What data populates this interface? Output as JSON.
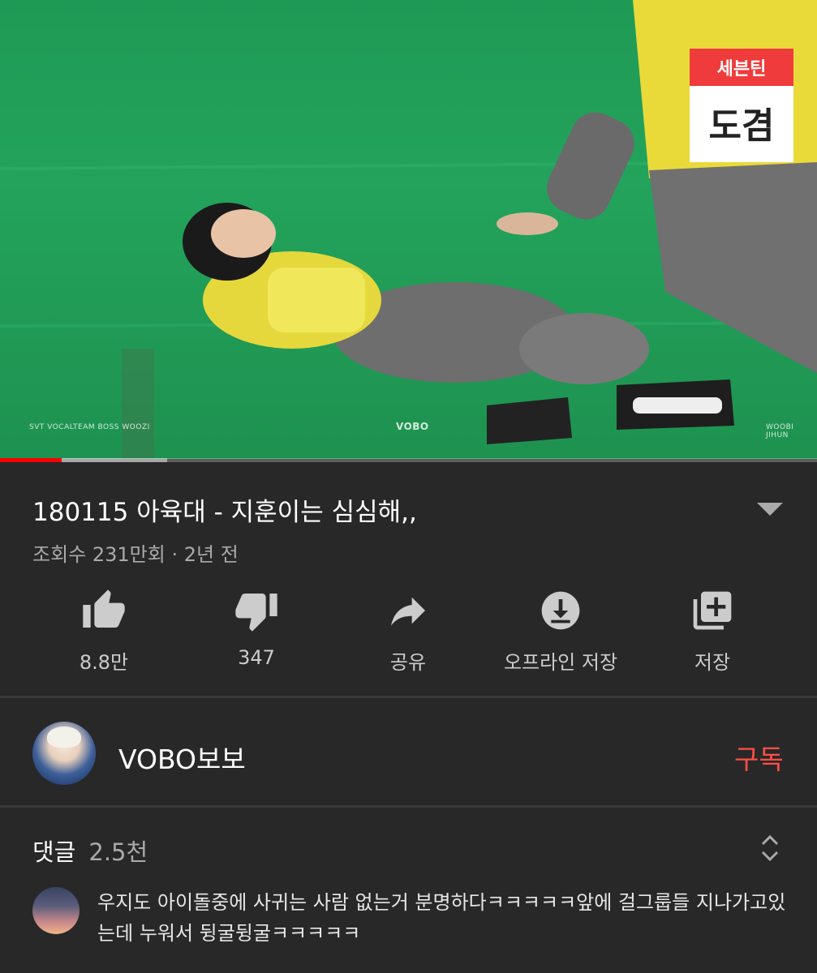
{
  "video": {
    "watermark_left": "SVT VOCALTEAM BOSS WOOZI",
    "watermark_center": "VOBO",
    "watermark_right": "WOOBI JIHUN",
    "nametag_team": "세븐틴",
    "nametag_name": "도겸",
    "progress_played": 0.075,
    "progress_buffered": 0.205
  },
  "title": "180115 아육대 - 지훈이는 심심해,,",
  "meta": "조회수 231만회 · 2년 전",
  "actions": {
    "like": "8.8만",
    "dislike": "347",
    "share": "공유",
    "download": "오프라인 저장",
    "save": "저장"
  },
  "channel": {
    "name": "VOBO보보",
    "subscribe": "구독"
  },
  "comments": {
    "label": "댓글",
    "count": "2.5천",
    "first": "우지도 아이돌중에 사귀는 사람 없는거 분명하다ㅋㅋㅋㅋㅋ앞에 걸그룹들 지나가고있는데 누워서 뒹굴뒹굴ㅋㅋㅋㅋㅋ"
  },
  "colors": {
    "background": "#282828",
    "subscribe_red": "#ff4e45",
    "progress_red": "#ff0000"
  }
}
